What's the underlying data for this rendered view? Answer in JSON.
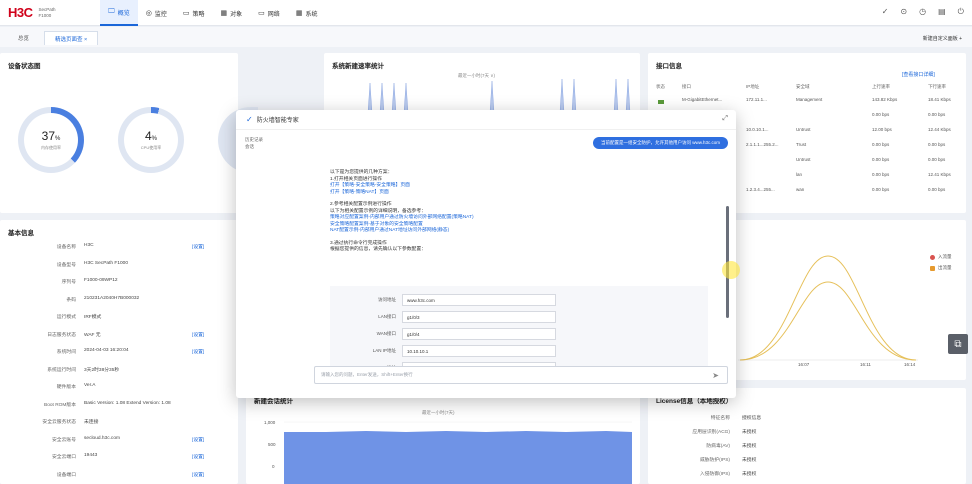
{
  "brand": {
    "logo": "H3C",
    "sub1": "SecPath",
    "sub2": "F1000"
  },
  "nav": [
    {
      "icon": "🖵",
      "label": "概览"
    },
    {
      "icon": "◎",
      "label": "监控"
    },
    {
      "icon": "▭",
      "label": "策略"
    },
    {
      "icon": "▦",
      "label": "对象"
    },
    {
      "icon": "▭",
      "label": "网络"
    },
    {
      "icon": "▦",
      "label": "系统"
    }
  ],
  "top_icons": [
    "✓",
    "⊙",
    "◷",
    "▤",
    "⏻"
  ],
  "subtabs": {
    "t1": "总览",
    "t2": "精选页面查 ×"
  },
  "subbar_right": "新建自定义面板 +",
  "device_status": {
    "title": "设备状态图",
    "rings": [
      {
        "value": "37",
        "unit": "%",
        "label": "内存使用率",
        "percent": 37,
        "color": "#4a7fe0"
      },
      {
        "value": "4",
        "unit": "%",
        "label": "CPU使用率",
        "percent": 4,
        "color": "#4a7fe0"
      }
    ]
  },
  "session_rate": {
    "title": "系统新建速率统计",
    "subtitle": "最近一小时(7天 ∨)"
  },
  "interfaces": {
    "title": "接口信息",
    "more_link": "[查看接口详细]",
    "headers": [
      "状态",
      "接口",
      "IP地址",
      "安全域",
      "上行速率",
      "下行速率"
    ],
    "rows": [
      {
        "iface": "M-GigabitEthernet...",
        "ip": "172.11.1...",
        "zone": "Management",
        "up": "143.82 Kbps",
        "down": "18.41 Kbps"
      },
      {
        "iface": "",
        "ip": "",
        "zone": "",
        "up": "0.00 bps",
        "down": "0.00 bps"
      },
      {
        "iface": "",
        "ip": "10.0.10.1...",
        "zone": "Untrust",
        "up": "12.00 bps",
        "down": "12.44 Kbps"
      },
      {
        "iface": "",
        "ip": "2.1.1.1...255.2...",
        "zone": "Trust",
        "up": "0.00 bps",
        "down": "0.00 bps"
      },
      {
        "iface": "",
        "ip": "",
        "zone": "Untrust",
        "up": "0.00 bps",
        "down": "0.00 bps"
      },
      {
        "iface": "",
        "ip": "",
        "zone": "lan",
        "up": "0.00 bps",
        "down": "12.41 Kbps"
      },
      {
        "iface": "",
        "ip": "1.2.3.4...255...",
        "zone": "wan",
        "up": "0.00 bps",
        "down": "0.00 bps"
      }
    ]
  },
  "basic_info": {
    "title": "基本信息",
    "rows": [
      {
        "k": "设备名称",
        "v": "H3C",
        "l": "[设置]"
      },
      {
        "k": "设备型号",
        "v": "H3C SecPath F1000",
        "l": ""
      },
      {
        "k": "序列号",
        "v": "F1000-09WP12",
        "l": ""
      },
      {
        "k": "条码",
        "v": "210231A2040H7B000032",
        "l": ""
      },
      {
        "k": "运行模式",
        "v": "IRF模式",
        "l": ""
      },
      {
        "k": "日志服务状态",
        "v": "WAF 无",
        "l": "[设置]"
      },
      {
        "k": "系统时间",
        "v": "2024-04-03 16:20:04",
        "l": "[设置]"
      },
      {
        "k": "系统运行时间",
        "v": "3天2时38分35秒",
        "l": ""
      },
      {
        "k": "硬件版本",
        "v": "Ver.A",
        "l": ""
      },
      {
        "k": "Boot ROM版本",
        "v": "Basic Version: 1.08 Extend Version: 1.08",
        "l": ""
      },
      {
        "k": "安全云服务状态",
        "v": "未连接",
        "l": ""
      },
      {
        "k": "安全云账号",
        "v": "secloud.h3c.com",
        "l": "[设置]"
      },
      {
        "k": "安全云端口",
        "v": "19443",
        "l": "[设置]"
      },
      {
        "k": "设备端口",
        "v": "",
        "l": "[设置]"
      }
    ]
  },
  "traffic_legend": [
    {
      "name": "入流量",
      "color": "#d9534f"
    },
    {
      "name": "出流量",
      "color": "#e69a2e"
    }
  ],
  "traffic_ticks": [
    "16:07",
    "16:11",
    "16:14"
  ],
  "session_stat": {
    "title": "新建会话统计",
    "subtitle": "最近一小时(7天)",
    "yticks": [
      "1,000",
      "500",
      "0"
    ]
  },
  "license": {
    "title": "License信息（本地授权）",
    "rows": [
      {
        "k": "特征名称",
        "v": "授权信息"
      },
      {
        "k": "应用层识别(ACG)",
        "v": "未授权"
      },
      {
        "k": "防病毒(AV)",
        "v": "未授权"
      },
      {
        "k": "威胁防护(IPS)",
        "v": "未授权"
      },
      {
        "k": "入侵防御(IPS)",
        "v": "未授权"
      }
    ]
  },
  "assistant": {
    "title": "防火墙智能专家",
    "expand_icon": "⤢",
    "history_line1": "历史记录",
    "history_line2": "会话",
    "question": "当前配置是一组安全防护，允许其他用户访问 www.h3c.com",
    "answer": [
      {
        "t": "以下是为您提供的几种方案：",
        "link": false
      },
      {
        "t": "1.打开相关页面进行操作",
        "link": false
      },
      {
        "t": "打开【策略-安全策略-安全策略】页面",
        "link": true
      },
      {
        "t": "打开【策略-策略NAT】页面",
        "link": true
      },
      {
        "t": "",
        "gap": true
      },
      {
        "t": "2.参考相关配置示例进行操作",
        "link": false
      },
      {
        "t": "以下为相关配置示例的详细说明，备选参考：",
        "link": false
      },
      {
        "t": "策略对应配置案例-内部用户通过防火墙访问外部网络配置(策略NAT)",
        "link": true
      },
      {
        "t": "安全策略配置案例-基于对象的安全策略配置",
        "link": true
      },
      {
        "t": "NAT配置示例-内部用户通过NAT地址访问外部网络(静态)",
        "link": true
      },
      {
        "t": "",
        "gap": true
      },
      {
        "t": "3.通过执行命令行完成操作",
        "link": false
      },
      {
        "t": "根据您提供的信息，请先确认以下参数配置：",
        "link": false
      }
    ],
    "form": [
      {
        "label": "访问地址",
        "value": "www.h3c.com"
      },
      {
        "label": "LAN接口",
        "value": "g1/0/3"
      },
      {
        "label": "WAN接口",
        "value": "g1/0/4"
      },
      {
        "label": "LAN IP地址",
        "value": "10.10.10.1"
      },
      {
        "label": "WAN IP地址",
        "value": "10.10.20.1"
      }
    ],
    "input_placeholder": "请输入您的问题，Enter发送，Shift+Enter换行",
    "send_icon": "➤"
  },
  "float_icon": "⧉"
}
